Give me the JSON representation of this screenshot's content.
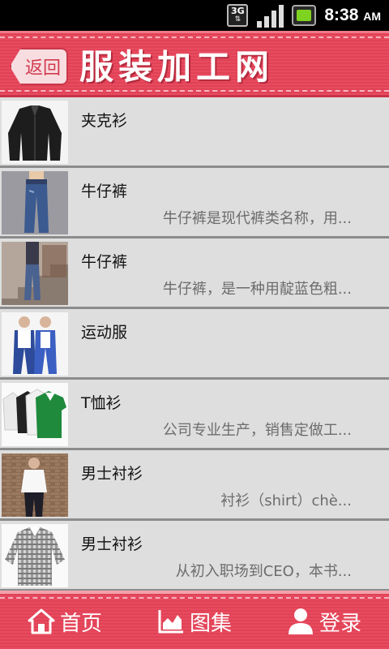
{
  "status_bar": {
    "network": "3G",
    "time": "8:38",
    "ampm": "AM"
  },
  "header": {
    "back_label": "返回",
    "title": "服装加工网"
  },
  "list": {
    "items": [
      {
        "title": "夹克衫",
        "desc": "",
        "image": "black-jacket"
      },
      {
        "title": "牛仔裤",
        "desc": "牛仔裤是现代裤类名称，用...",
        "image": "blue-jeans"
      },
      {
        "title": "牛仔裤",
        "desc": "牛仔裤，是一种用靛蓝色粗...",
        "image": "jeans-on-stairs"
      },
      {
        "title": "运动服",
        "desc": "",
        "image": "tracksuit-couple"
      },
      {
        "title": "T恤衫",
        "desc": "公司专业生产，销售定做工...",
        "image": "polo-shirts"
      },
      {
        "title": "男士衬衫",
        "desc": "衬衫（shirt）chè...",
        "image": "man-in-shirt"
      },
      {
        "title": "男士衬衫",
        "desc": "从初入职场到CEO，本书...",
        "image": "checked-shirt"
      }
    ]
  },
  "bottom_nav": {
    "home_label": "首页",
    "gallery_label": "图集",
    "login_label": "登录"
  },
  "colors": {
    "brand": "#e84a5f",
    "row_bg": "#dedede",
    "desc_text": "#6c6c6c"
  }
}
